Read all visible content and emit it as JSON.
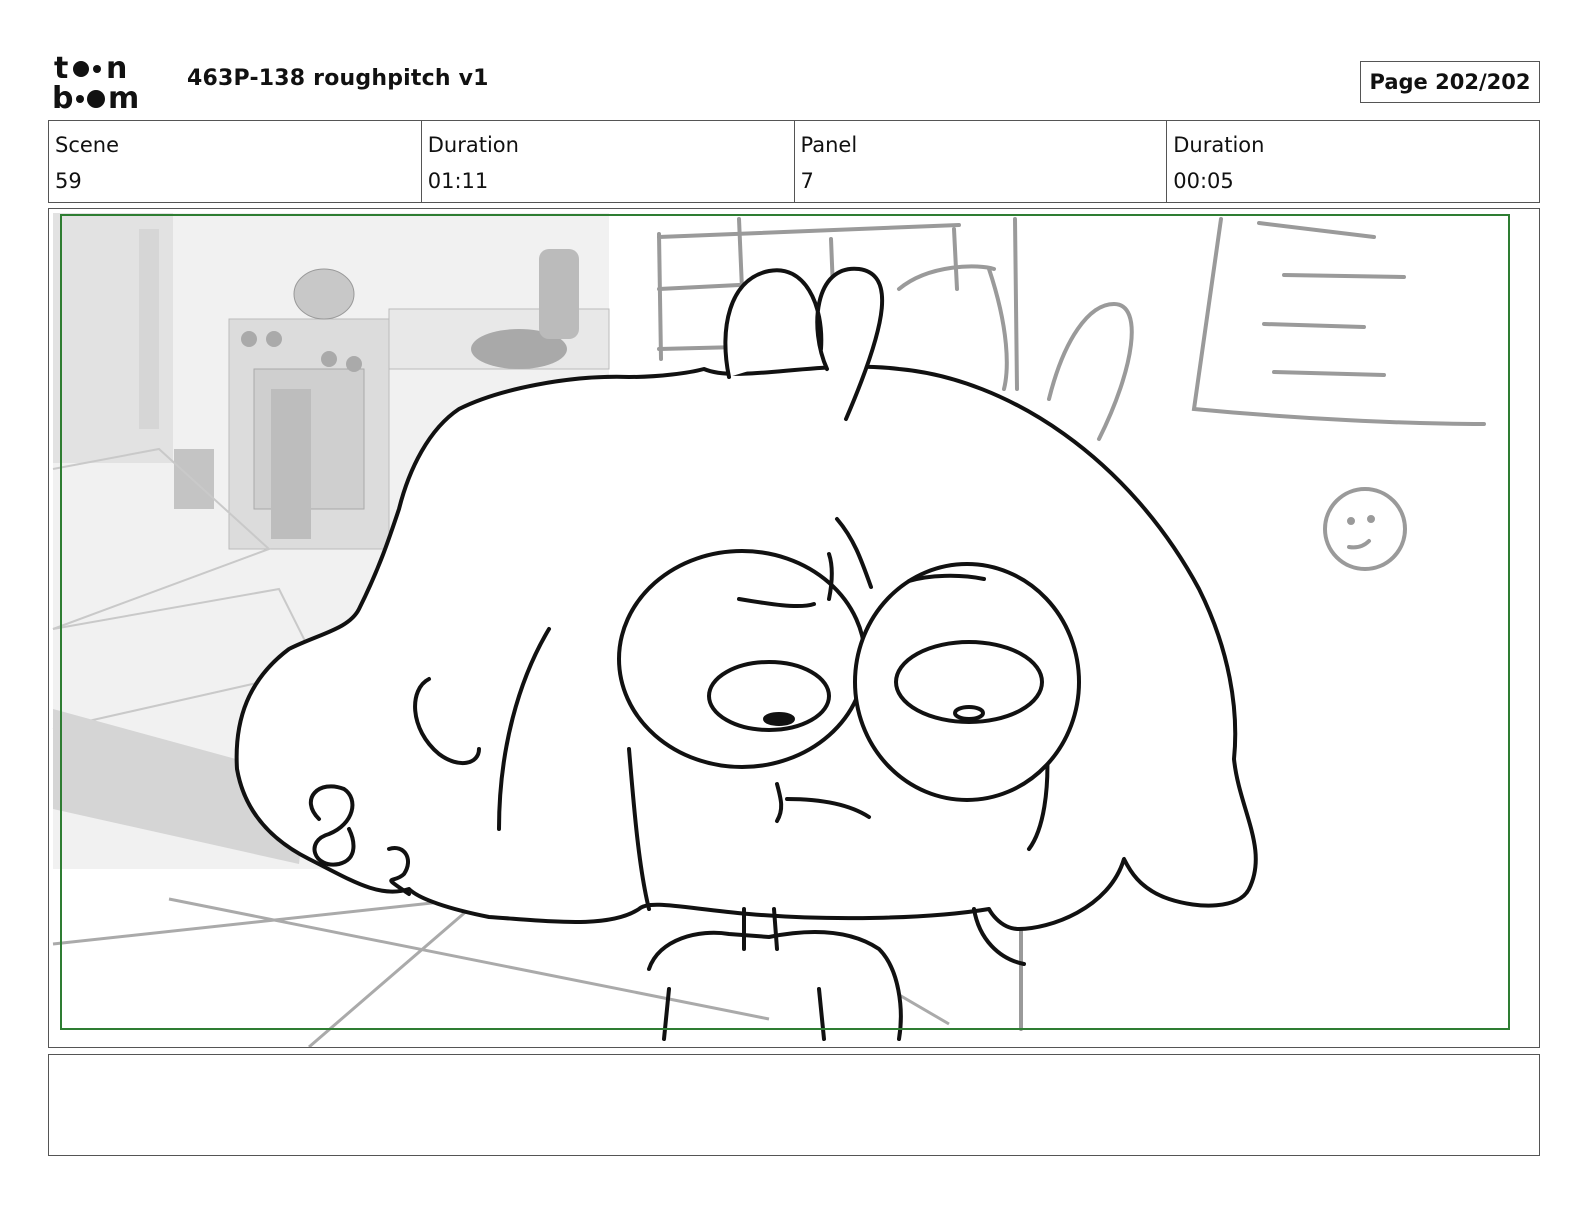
{
  "header": {
    "logo_text": "toon boom",
    "title": "463P-138 roughpitch v1",
    "page_label": "Page 202/202"
  },
  "info": {
    "scene_label": "Scene",
    "scene_value": "59",
    "scene_duration_label": "Duration",
    "scene_duration_value": "01:11",
    "panel_label": "Panel",
    "panel_value": "7",
    "panel_duration_label": "Duration",
    "panel_duration_value": "00:05"
  },
  "panel": {
    "safe_frame_color": "#2e7d32"
  },
  "notes": {
    "text": ""
  }
}
